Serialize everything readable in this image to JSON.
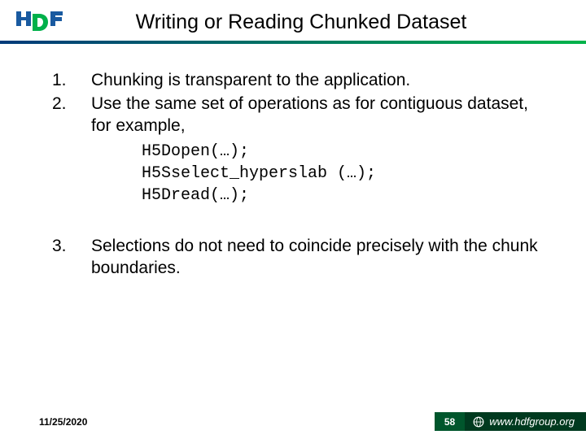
{
  "header": {
    "title": "Writing or Reading Chunked Dataset"
  },
  "bullets": {
    "n1": "1.",
    "t1": "Chunking is transparent to the application.",
    "n2": "2.",
    "t2": "Use the same set of operations as for contiguous dataset, for example,",
    "code1": "H5Dopen(…);",
    "code2": "H5Sselect_hyperslab (…);",
    "code3": "H5Dread(…);",
    "n3": "3.",
    "t3": "Selections do not need to coincide precisely with the chunk boundaries."
  },
  "footer": {
    "date": "11/25/2020",
    "page": "58",
    "site": "www.hdfgroup.org"
  },
  "colors": {
    "rule_start": "#003a7a",
    "rule_end": "#00b34a",
    "footer_bg": "#003a1f",
    "page_bg": "#00562c"
  }
}
